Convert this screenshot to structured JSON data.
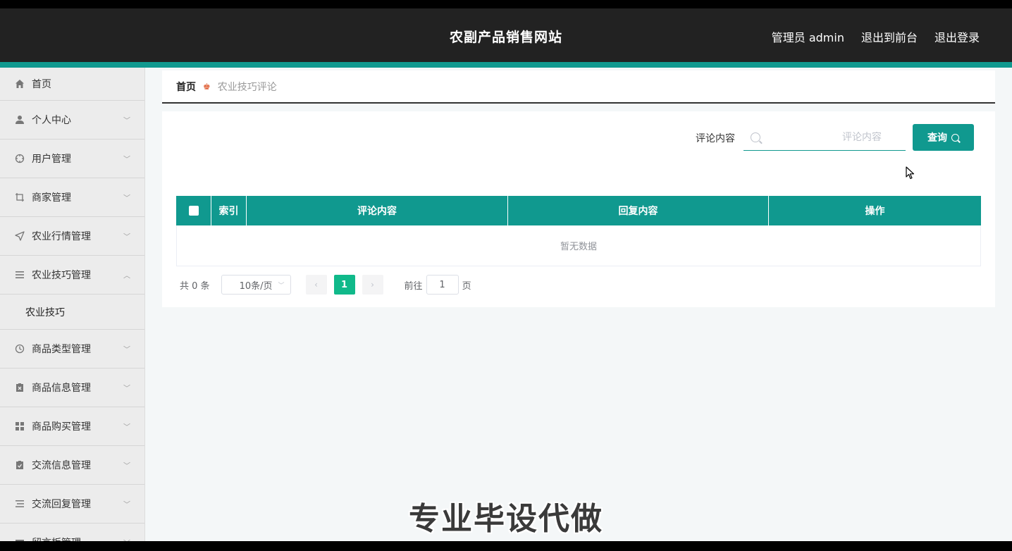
{
  "header": {
    "title": "农副产品销售网站",
    "admin_label": "管理员 admin",
    "to_front": "退出到前台",
    "logout": "退出登录"
  },
  "sidebar": {
    "items": [
      {
        "label": "首页",
        "icon": "home-icon"
      },
      {
        "label": "个人中心",
        "icon": "user-icon"
      },
      {
        "label": "用户管理",
        "icon": "crosshair-icon"
      },
      {
        "label": "商家管理",
        "icon": "crop-icon"
      },
      {
        "label": "农业行情管理",
        "icon": "send-icon"
      },
      {
        "label": "农业技巧管理",
        "icon": "menu-icon"
      },
      {
        "label": "商品类型管理",
        "icon": "clock-icon"
      },
      {
        "label": "商品信息管理",
        "icon": "clipboard-x-icon"
      },
      {
        "label": "商品购买管理",
        "icon": "grid-icon"
      },
      {
        "label": "交流信息管理",
        "icon": "clipboard-check-icon"
      },
      {
        "label": "交流回复管理",
        "icon": "list-icon"
      },
      {
        "label": "留言板管理",
        "icon": "mail-icon"
      }
    ],
    "sub_item": "农业技巧"
  },
  "breadcrumb": {
    "home": "首页",
    "current": "农业技巧评论"
  },
  "search": {
    "label": "评论内容",
    "placeholder": "评论内容",
    "button": "查询"
  },
  "table": {
    "columns": [
      "索引",
      "评论内容",
      "回复内容",
      "操作"
    ],
    "empty_text": "暂无数据"
  },
  "pagination": {
    "total": "共 0 条",
    "page_size": "10条/页",
    "current_page": "1",
    "goto_prefix": "前往",
    "goto_value": "1",
    "goto_suffix": "页"
  },
  "watermark": "专业毕设代做",
  "colors": {
    "primary": "#10998f",
    "header_bg": "#222222",
    "active_page": "#10b98a"
  }
}
